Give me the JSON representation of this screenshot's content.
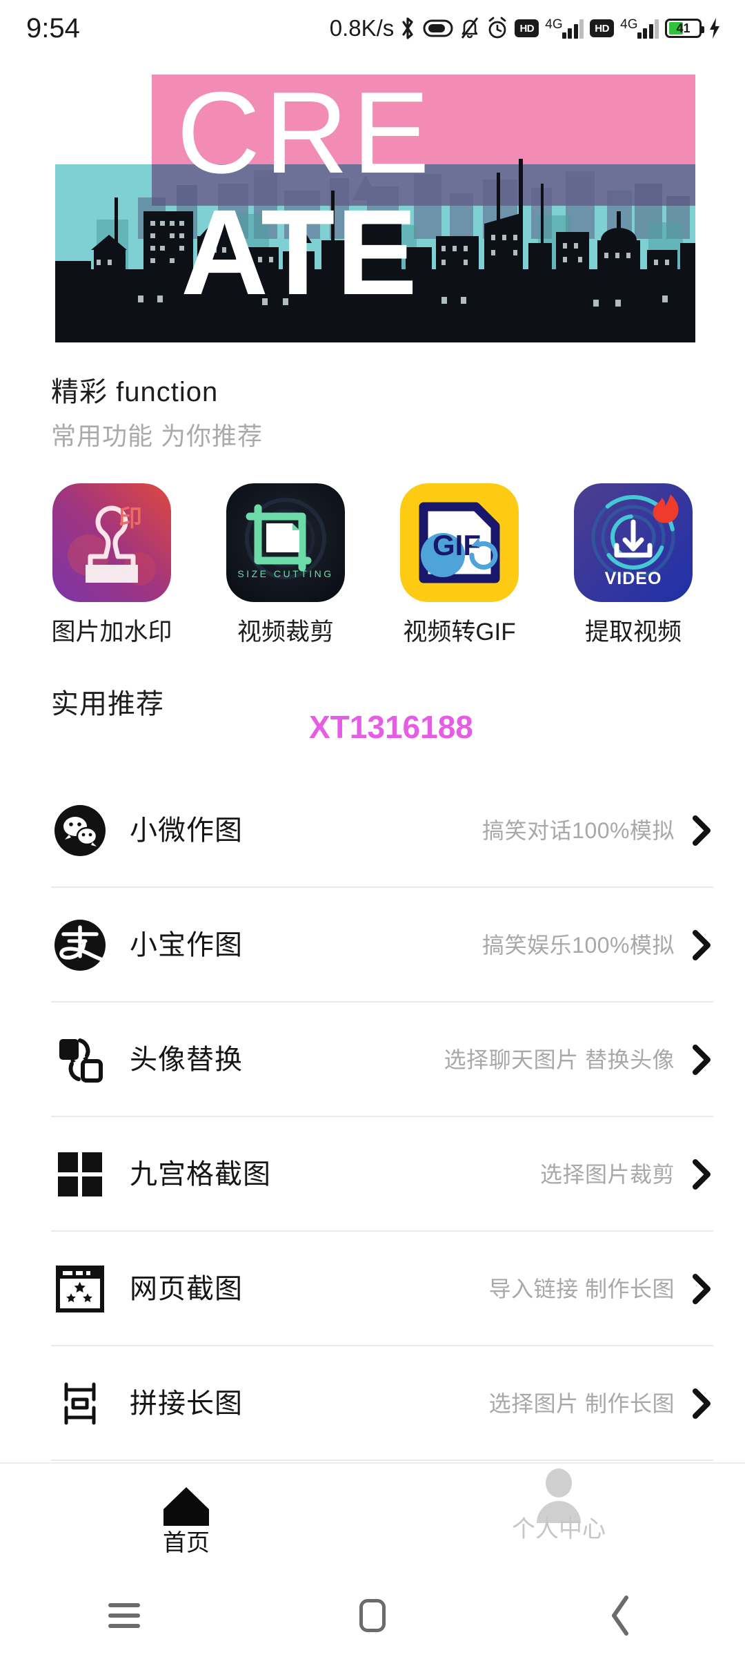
{
  "status_bar": {
    "time": "9:54",
    "network_speed": "0.8K/s",
    "icons": [
      "bluetooth-icon",
      "vpn-icon",
      "mute-icon",
      "alarm-icon",
      "hd-icon",
      "signal-4g-icon",
      "hd-icon-2",
      "signal-4g-icon-2",
      "battery-icon",
      "charging-bolt-icon"
    ],
    "hd_label": "HD",
    "hd_label_2": "HD",
    "network_type": "4G",
    "network_type_2": "4G",
    "battery_level": "41"
  },
  "banner": {
    "name": "create-banner",
    "line1": "CRE",
    "line2": "ATE",
    "colors": {
      "pink": "#f08ab4",
      "teal": "#7fd0d2",
      "purple": "#6d7197",
      "dark": "#0d0f14"
    }
  },
  "section_function": {
    "title": "精彩 function",
    "subtitle": "常用功能 为你推荐"
  },
  "features": [
    {
      "label": "图片加水印",
      "icon": "stamp-icon",
      "badge_text": "印"
    },
    {
      "label": "视频裁剪",
      "icon": "crop-icon",
      "badge_text": "SIZE CUTTING"
    },
    {
      "label": "视频转GIF",
      "icon": "gif-file-icon",
      "badge_text": "GIF"
    },
    {
      "label": "提取视频",
      "icon": "video-download-icon",
      "badge_text": "VIDEO"
    }
  ],
  "section_recommend": {
    "title": "实用推荐",
    "watermark": "XT1316188"
  },
  "list_items": [
    {
      "title": "小微作图",
      "desc": "搞笑对话100%模拟",
      "icon": "wechat-icon"
    },
    {
      "title": "小宝作图",
      "desc": "搞笑娱乐100%模拟",
      "icon": "alipay-icon"
    },
    {
      "title": "头像替换",
      "desc": "选择聊天图片 替换头像",
      "icon": "swap-avatar-icon"
    },
    {
      "title": "九宫格截图",
      "desc": "选择图片裁剪",
      "icon": "grid-icon"
    },
    {
      "title": "网页截图",
      "desc": "导入链接 制作长图",
      "icon": "browser-window-icon"
    },
    {
      "title": "拼接长图",
      "desc": "选择图片 制作长图",
      "icon": "stitch-icon"
    }
  ],
  "tab_bar": [
    {
      "label": "首页",
      "icon": "home-icon",
      "active": true
    },
    {
      "label": "个人中心",
      "icon": "person-icon",
      "active": false
    }
  ],
  "nav_bar": [
    {
      "icon": "recents-menu-icon"
    },
    {
      "icon": "home-square-icon"
    },
    {
      "icon": "back-chevron-icon"
    }
  ],
  "colors": {
    "accent_pink": "#e65ce6",
    "text_primary": "#151515",
    "text_secondary": "#a8a8a8",
    "battery_green": "#31c13b"
  }
}
